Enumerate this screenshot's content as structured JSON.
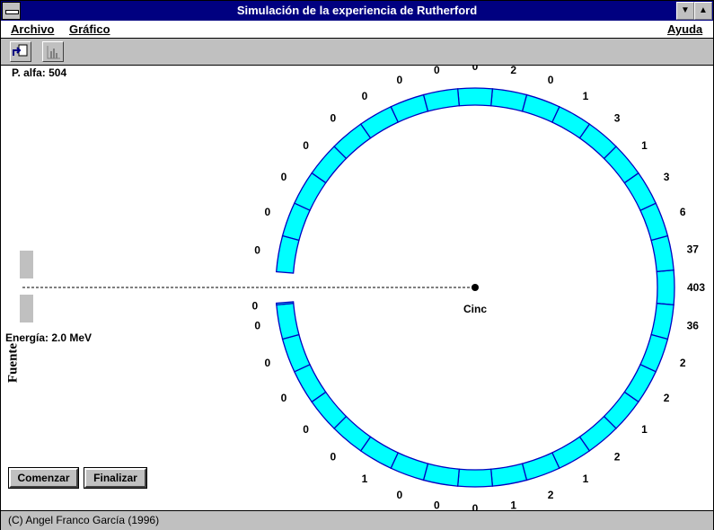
{
  "window": {
    "title": "Simulación de la experiencia de Rutherford",
    "minimize_glyph": "▼",
    "maximize_glyph": "▲"
  },
  "menu": {
    "archivo": "Archivo",
    "grafico": "Gráfico",
    "ayuda": "Ayuda"
  },
  "toolbar": {
    "tools": [
      {
        "name": "new-simulation-icon"
      },
      {
        "name": "histogram-icon"
      }
    ]
  },
  "sim": {
    "particles_label": "P. alfa: 504",
    "energy_label": "Energía: 2.0 MeV",
    "source_label": "Fuente",
    "target_label": "Cinc",
    "detector_fill": "#00ffff",
    "detector_stroke": "#0000c0",
    "counts_upper": [
      403,
      37,
      6,
      3,
      1,
      3,
      1,
      0,
      2,
      0,
      0,
      0,
      0,
      0,
      0,
      0,
      0,
      0
    ],
    "counts_lower": [
      36,
      2,
      2,
      1,
      2,
      1,
      2,
      1,
      0,
      0,
      0,
      1,
      0,
      0,
      0,
      0,
      0,
      0
    ]
  },
  "buttons": {
    "start": "Comenzar",
    "finish": "Finalizar"
  },
  "status": {
    "text": "(C) Angel Franco García (1996)"
  }
}
